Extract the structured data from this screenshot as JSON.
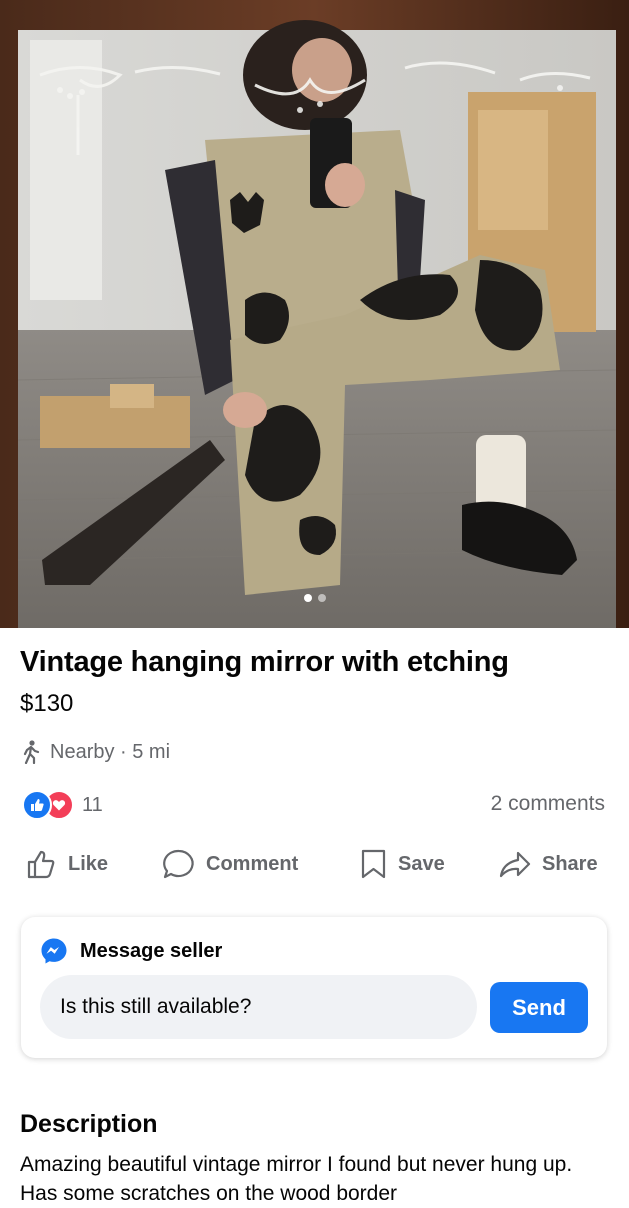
{
  "listing": {
    "title": "Vintage hanging mirror with etching",
    "price": "$130",
    "location": "Nearby · 5 mi",
    "reaction_count": "11",
    "comments": "2 comments"
  },
  "photo": {
    "total_images": 2,
    "current_image": 1
  },
  "actions": {
    "like": "Like",
    "comment": "Comment",
    "save": "Save",
    "share": "Share"
  },
  "message": {
    "title": "Message seller",
    "input_value": "Is this still available?",
    "send": "Send"
  },
  "description": {
    "title": "Description",
    "text": "Amazing beautiful vintage mirror I found but never hung up. Has some scratches on the wood border"
  },
  "colors": {
    "accent": "#1877f2",
    "love": "#f33e58",
    "muted_text": "#65676b",
    "input_bg": "#f0f2f5"
  },
  "icons": {
    "walk": "walking-person-icon",
    "like": "thumbs-up-icon",
    "love": "heart-icon",
    "comment": "speech-bubble-icon",
    "save": "bookmark-icon",
    "share": "share-arrow-icon",
    "messenger": "messenger-icon"
  }
}
